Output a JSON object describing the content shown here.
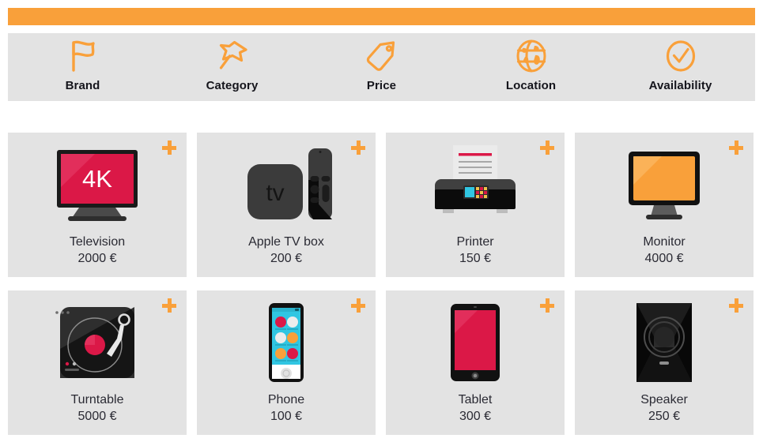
{
  "theme": {
    "accent": "#f9a03a",
    "panel_bg": "#e3e3e3",
    "page_bg": "#ffffff",
    "text": "#2a2a33",
    "heading_text": "#15151c",
    "product_pink": "#db1847"
  },
  "topbar": {
    "name": "orange-banner"
  },
  "filters": {
    "items": [
      {
        "label": "Brand",
        "icon": "flag-icon"
      },
      {
        "label": "Category",
        "icon": "pushpin-icon"
      },
      {
        "label": "Price",
        "icon": "price-tag-icon"
      },
      {
        "label": "Location",
        "icon": "globe-icon"
      },
      {
        "label": "Availability",
        "icon": "check-circle-icon"
      }
    ]
  },
  "products": {
    "add_label": "+",
    "items": [
      {
        "name": "Television",
        "price": "2000 €",
        "icon": "television-icon",
        "screen_text": "4K"
      },
      {
        "name": "Apple TV box",
        "price": "200 €",
        "icon": "apple-tv-box-icon",
        "screen_text": "tv"
      },
      {
        "name": "Printer",
        "price": "150 €",
        "icon": "printer-icon",
        "screen_text": ""
      },
      {
        "name": "Monitor",
        "price": "4000 €",
        "icon": "monitor-icon",
        "screen_text": ""
      },
      {
        "name": "Turntable",
        "price": "5000 €",
        "icon": "turntable-icon",
        "screen_text": ""
      },
      {
        "name": "Phone",
        "price": "100 €",
        "icon": "phone-icon",
        "screen_text": ""
      },
      {
        "name": "Tablet",
        "price": "300 €",
        "icon": "tablet-icon",
        "screen_text": ""
      },
      {
        "name": "Speaker",
        "price": "250 €",
        "icon": "speaker-icon",
        "screen_text": ""
      }
    ]
  }
}
